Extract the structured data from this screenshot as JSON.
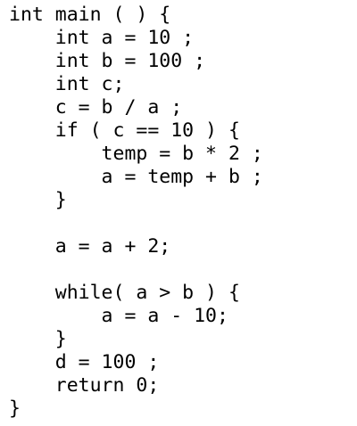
{
  "code": {
    "lines": [
      "int main ( ) {",
      "    int a = 10 ;",
      "    int b = 100 ;",
      "    int c;",
      "    c = b / a ;",
      "    if ( c == 10 ) {",
      "        temp = b * 2 ;",
      "        a = temp + b ;",
      "    }",
      "",
      "    a = a + 2;",
      "",
      "    while( a > b ) {",
      "        a = a - 10;",
      "    }",
      "    d = 100 ;",
      "    return 0;",
      "}"
    ]
  }
}
